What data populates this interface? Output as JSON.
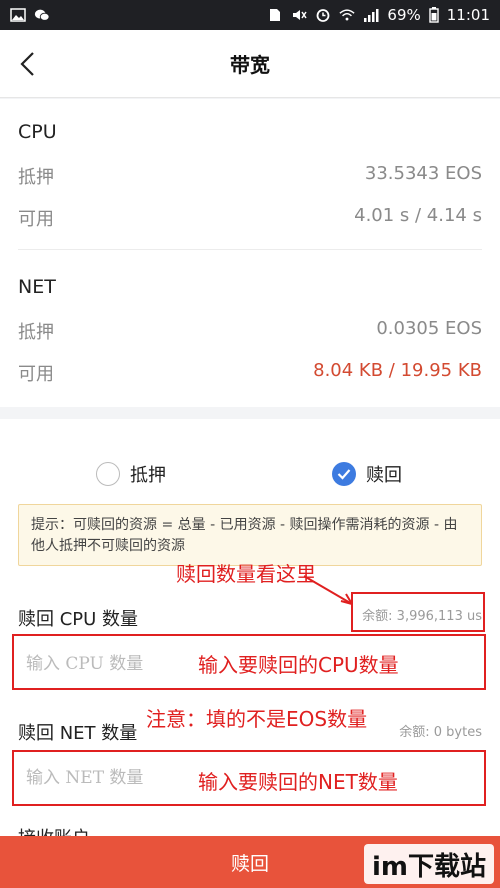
{
  "status_bar": {
    "battery": "69%",
    "time": "11:01",
    "icons": [
      "image-icon",
      "wechat-icon",
      "sim-icon",
      "mute-icon",
      "alarm-icon",
      "wifi-icon",
      "signal-icon",
      "battery-icon"
    ]
  },
  "header": {
    "title": "带宽",
    "back_icon": "chevron-left-icon"
  },
  "cpu": {
    "title": "CPU",
    "staked_label": "抵押",
    "staked_value": "33.5343 EOS",
    "available_label": "可用",
    "available_value": "4.01 s / 4.14 s"
  },
  "net": {
    "title": "NET",
    "staked_label": "抵押",
    "staked_value": "0.0305 EOS",
    "available_label": "可用",
    "available_value": "8.04 KB / 19.95 KB"
  },
  "mode": {
    "options": [
      {
        "label": "抵押",
        "selected": false
      },
      {
        "label": "赎回",
        "selected": true
      }
    ]
  },
  "tip": "提示：可赎回的资源 = 总量 - 已用资源 - 赎回操作需消耗的资源 - 由他人抵押不可赎回的资源",
  "cpu_redeem": {
    "label": "赎回 CPU 数量",
    "balance": "余额: 3,996,113 us",
    "placeholder": "输入 CPU 数量"
  },
  "net_redeem": {
    "label": "赎回 NET 数量",
    "balance": "余额: 0 bytes",
    "placeholder": "输入 NET 数量"
  },
  "next_label_partial": "接收账户",
  "submit_label": "赎回",
  "annotations": {
    "look_here": "赎回数量看这里",
    "input_cpu": "输入要赎回的CPU数量",
    "note": "注意：填的不是EOS数量",
    "input_net": "输入要赎回的NET数量"
  },
  "watermark": "im下载站",
  "colors": {
    "accent_red": "#e8533b",
    "value_red": "#d34a31",
    "radio_blue": "#3d7be0",
    "annotation_red": "#e02020",
    "tip_bg": "#fdf8e8"
  }
}
